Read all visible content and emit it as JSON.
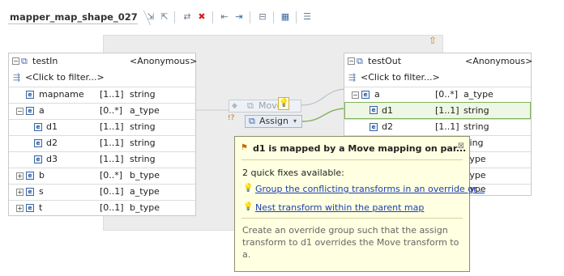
{
  "editor": {
    "title": "mapper_map_shape_027",
    "toolbar_icons": [
      "add-input-icon",
      "add-output-icon",
      "remove-icon",
      "delete-icon",
      "left-align-icon",
      "right-align-icon",
      "layout-icon",
      "table-view-icon",
      "properties-icon"
    ]
  },
  "input": {
    "name": "testIn",
    "type": "<Anonymous>",
    "filter": "<Click to filter...>",
    "rows": [
      {
        "name": "mapname",
        "card": "[1..1]",
        "type": "string"
      },
      {
        "name": "a",
        "card": "[0..*]",
        "type": "a_type"
      },
      {
        "name": "d1",
        "card": "[1..1]",
        "type": "string"
      },
      {
        "name": "d2",
        "card": "[1..1]",
        "type": "string"
      },
      {
        "name": "d3",
        "card": "[1..1]",
        "type": "string"
      },
      {
        "name": "b",
        "card": "[0..*]",
        "type": "b_type"
      },
      {
        "name": "s",
        "card": "[0..1]",
        "type": "a_type"
      },
      {
        "name": "t",
        "card": "[0..1]",
        "type": "b_type"
      }
    ]
  },
  "output": {
    "name": "testOut",
    "type": "<Anonymous>",
    "filter": "<Click to filter...>",
    "rows": [
      {
        "name": "a",
        "card": "[0..*]",
        "type": "a_type"
      },
      {
        "name": "d1",
        "card": "[1..1]",
        "type": "string"
      },
      {
        "name": "d2",
        "card": "[1..1]",
        "type": "string"
      },
      {
        "name": "",
        "card": "",
        "type": "ring"
      },
      {
        "name": "",
        "card": "",
        "type": "type"
      },
      {
        "name": "",
        "card": "",
        "type": "type"
      },
      {
        "name": "",
        "card": "",
        "type": "type"
      }
    ]
  },
  "transforms": {
    "move": "Move",
    "assign": "Assign"
  },
  "quickfix": {
    "title": "d1 is mapped by a Move mapping on par...",
    "count_text": "2 quick fixes available:",
    "fixes": [
      "Group the conflicting transforms in an override gr...",
      "Nest transform within the parent map"
    ],
    "description": "Create an override group such that the assign transform to d1 overrides the Move transform to a."
  },
  "colors": {
    "link": "#1a3fb4",
    "popup_bg": "#ffffe1",
    "connection": "#7fb45a"
  }
}
